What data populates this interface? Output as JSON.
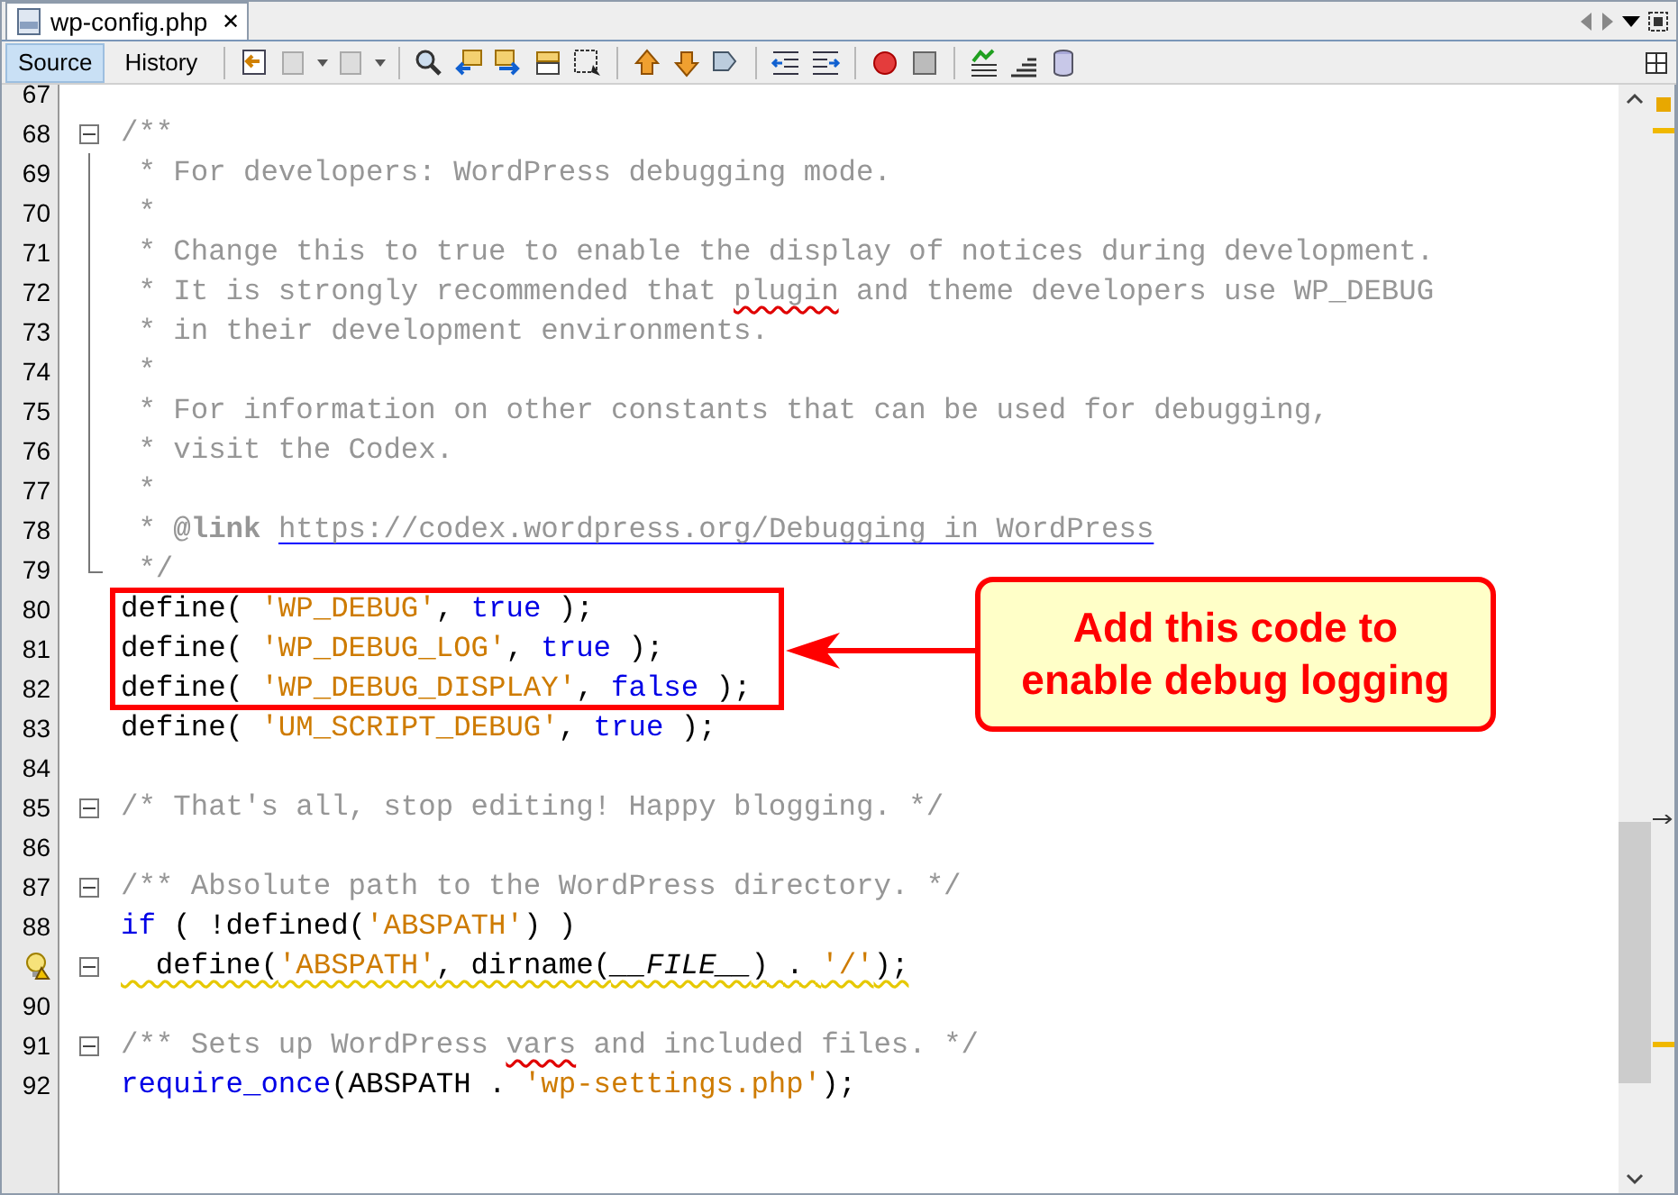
{
  "file_tab": {
    "title": "wp-config.php",
    "close": "✕"
  },
  "view_tabs": [
    {
      "label": "Source",
      "selected": true
    },
    {
      "label": "History",
      "selected": false
    }
  ],
  "lines": [
    {
      "number": "67"
    },
    {
      "number": "68",
      "fold_toggle": true,
      "segments": [
        {
          "text": "/**",
          "kind": "comment"
        }
      ]
    },
    {
      "number": "69",
      "fold_guide": true,
      "segments": [
        {
          "text": " * For developers: WordPress debugging mode.",
          "kind": "comment"
        }
      ]
    },
    {
      "number": "70",
      "fold_guide": true,
      "segments": [
        {
          "text": " *",
          "kind": "comment"
        }
      ]
    },
    {
      "number": "71",
      "fold_guide": true,
      "segments": [
        {
          "text": " * Change this to true to enable the display of notices during development.",
          "kind": "comment"
        }
      ]
    },
    {
      "number": "72",
      "fold_guide": true,
      "segments": [
        {
          "text": " * It is strongly recommended that ",
          "kind": "comment"
        },
        {
          "text": "plugin",
          "kind": "comment",
          "misspelled": true
        },
        {
          "text": " and theme developers use WP_DEBUG",
          "kind": "comment"
        }
      ]
    },
    {
      "number": "73",
      "fold_guide": true,
      "segments": [
        {
          "text": " * in their development environments.",
          "kind": "comment"
        }
      ]
    },
    {
      "number": "74",
      "fold_guide": true,
      "segments": [
        {
          "text": " *",
          "kind": "comment"
        }
      ]
    },
    {
      "number": "75",
      "fold_guide": true,
      "segments": [
        {
          "text": " * For information on other constants that can be used for debugging,",
          "kind": "comment"
        }
      ]
    },
    {
      "number": "76",
      "fold_guide": true,
      "segments": [
        {
          "text": " * visit the Codex.",
          "kind": "comment"
        }
      ]
    },
    {
      "number": "77",
      "fold_guide": true,
      "segments": [
        {
          "text": " *",
          "kind": "comment"
        }
      ]
    },
    {
      "number": "78",
      "fold_guide": true,
      "segments": [
        {
          "text": " * ",
          "kind": "comment"
        },
        {
          "text": "@link ",
          "kind": "tag"
        },
        {
          "text": "https://codex.wordpress.org/Debugging in WordPress",
          "kind": "comment",
          "link": true
        }
      ]
    },
    {
      "number": "79",
      "fold_guide": true,
      "fold_end": true,
      "segments": [
        {
          "text": " */",
          "kind": "comment"
        }
      ]
    },
    {
      "number": "80",
      "segments": [
        {
          "text": "define( ",
          "kind": "plain"
        },
        {
          "text": "'WP_DEBUG'",
          "kind": "string"
        },
        {
          "text": ", ",
          "kind": "plain"
        },
        {
          "text": "true",
          "kind": "keyword"
        },
        {
          "text": " );",
          "kind": "plain"
        }
      ]
    },
    {
      "number": "81",
      "segments": [
        {
          "text": "define( ",
          "kind": "plain"
        },
        {
          "text": "'WP_DEBUG_LOG'",
          "kind": "string"
        },
        {
          "text": ", ",
          "kind": "plain"
        },
        {
          "text": "true",
          "kind": "keyword"
        },
        {
          "text": " );",
          "kind": "plain"
        }
      ]
    },
    {
      "number": "82",
      "segments": [
        {
          "text": "define( ",
          "kind": "plain"
        },
        {
          "text": "'WP_DEBUG_DISPLAY'",
          "kind": "string"
        },
        {
          "text": ", ",
          "kind": "plain"
        },
        {
          "text": "false",
          "kind": "keyword"
        },
        {
          "text": " );",
          "kind": "plain"
        }
      ]
    },
    {
      "number": "83",
      "segments": [
        {
          "text": "define( ",
          "kind": "plain"
        },
        {
          "text": "'UM_SCRIPT_DEBUG'",
          "kind": "string"
        },
        {
          "text": ", ",
          "kind": "plain"
        },
        {
          "text": "true",
          "kind": "keyword"
        },
        {
          "text": " );",
          "kind": "plain"
        }
      ]
    },
    {
      "number": "84"
    },
    {
      "number": "85",
      "fold_toggle": true,
      "segments": [
        {
          "text": "/* That's all, stop editing! Happy blogging. */",
          "kind": "comment"
        }
      ]
    },
    {
      "number": "86"
    },
    {
      "number": "87",
      "fold_toggle": true,
      "segments": [
        {
          "text": "/** Absolute path to the WordPress directory. */",
          "kind": "comment"
        }
      ]
    },
    {
      "number": "88",
      "segments": [
        {
          "text": "if",
          "kind": "keyword"
        },
        {
          "text": " ( !defined(",
          "kind": "plain"
        },
        {
          "text": "'ABSPATH'",
          "kind": "string"
        },
        {
          "text": ") )",
          "kind": "plain"
        }
      ]
    },
    {
      "hint": true,
      "fold_toggle": true,
      "warning": true,
      "segments": [
        {
          "text": "  define(",
          "kind": "plain"
        },
        {
          "text": "'ABSPATH'",
          "kind": "string"
        },
        {
          "text": ", dirname(",
          "kind": "plain"
        },
        {
          "text": "__FILE__",
          "kind": "constant"
        },
        {
          "text": ") . ",
          "kind": "plain"
        },
        {
          "text": "'/'",
          "kind": "string"
        },
        {
          "text": ");",
          "kind": "plain"
        }
      ]
    },
    {
      "number": "90"
    },
    {
      "number": "91",
      "fold_toggle": true,
      "segments": [
        {
          "text": "/** Sets up WordPress ",
          "kind": "comment"
        },
        {
          "text": "vars",
          "kind": "comment",
          "misspelled": true
        },
        {
          "text": " and included files. */",
          "kind": "comment"
        }
      ]
    },
    {
      "number": "92",
      "segments": [
        {
          "text": "require_once",
          "kind": "keyword"
        },
        {
          "text": "(ABSPATH . ",
          "kind": "plain"
        },
        {
          "text": "'wp-settings.php'",
          "kind": "string"
        },
        {
          "text": ");",
          "kind": "plain"
        }
      ]
    }
  ],
  "callout": {
    "text": "Add this code to enable debug logging"
  }
}
